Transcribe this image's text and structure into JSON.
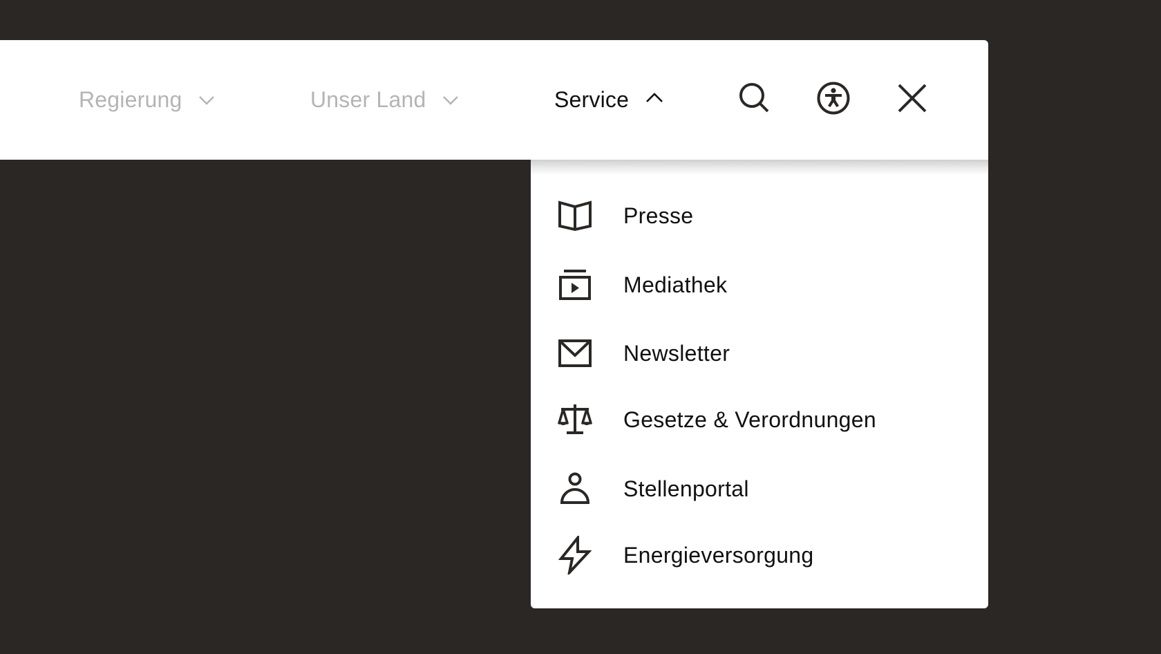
{
  "header": {
    "nav": [
      {
        "label": "Regierung",
        "state": "collapsed",
        "icon": "chevron-down-icon"
      },
      {
        "label": "Unser Land",
        "state": "collapsed",
        "icon": "chevron-down-icon"
      },
      {
        "label": "Service",
        "state": "expanded",
        "icon": "chevron-up-icon"
      }
    ],
    "actions": [
      {
        "name": "search",
        "icon": "search-icon"
      },
      {
        "name": "accessibility",
        "icon": "accessibility-icon"
      },
      {
        "name": "close",
        "icon": "close-icon"
      }
    ]
  },
  "service_menu": {
    "items": [
      {
        "label": "Presse",
        "icon": "open-book-icon"
      },
      {
        "label": "Mediathek",
        "icon": "media-play-icon"
      },
      {
        "label": "Newsletter",
        "icon": "envelope-icon"
      },
      {
        "label": "Gesetze & Verordnungen",
        "icon": "scales-icon"
      },
      {
        "label": "Stellenportal",
        "icon": "person-icon"
      },
      {
        "label": "Energieversorgung",
        "icon": "lightning-icon"
      }
    ]
  },
  "colors": {
    "background": "#2a2725",
    "surface": "#ffffff",
    "text_active": "#111111",
    "text_inactive": "#b4b4b4",
    "icon": "#2a2725"
  }
}
